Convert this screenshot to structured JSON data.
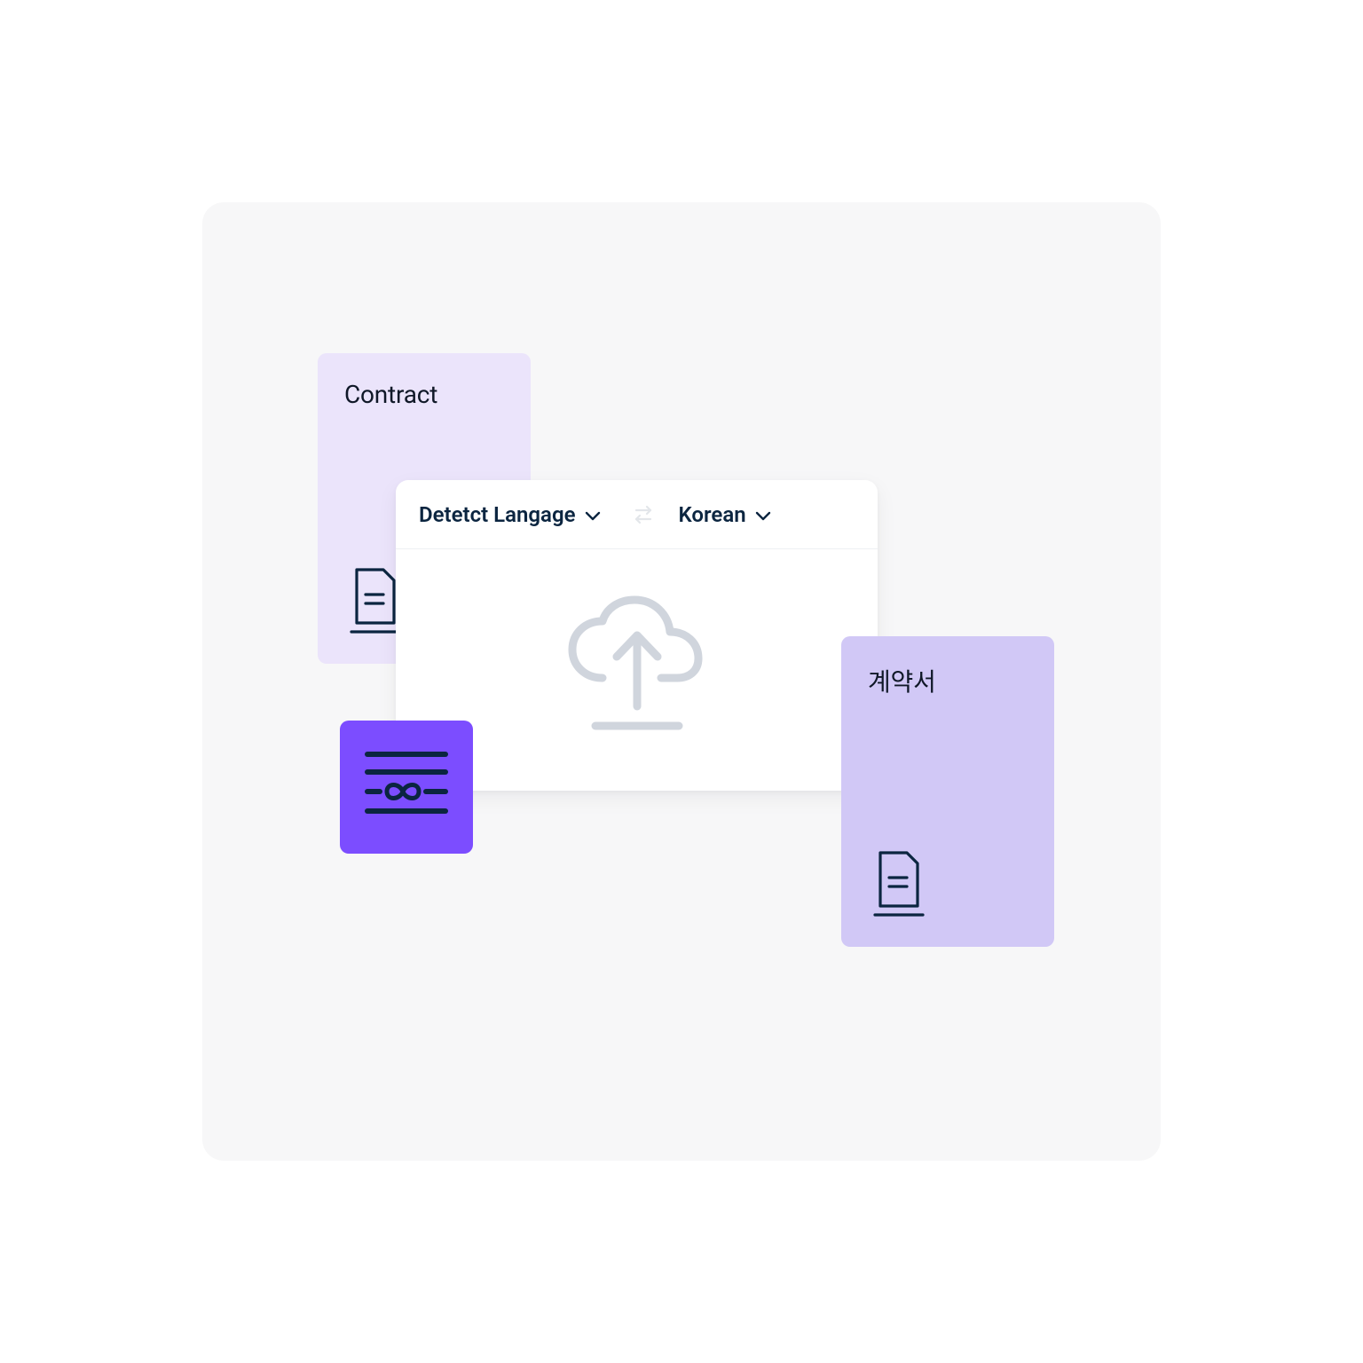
{
  "translator": {
    "source_language_label": "Detetct Langage",
    "target_language_label": "Korean"
  },
  "cards": {
    "source": {
      "title": "Contract"
    },
    "target": {
      "title": "계약서"
    }
  },
  "colors": {
    "ink": "#0b2540",
    "lavender_light": "#ebe4fb",
    "lavender": "#d1c8f6",
    "purple": "#7c4dff",
    "panel_bg": "#ffffff",
    "stage_bg": "#f7f7f8",
    "upload_icon": "#d0d5dd"
  },
  "icons": {
    "doc": "document-icon",
    "swap": "swap-arrows-icon",
    "upload": "cloud-upload-icon",
    "infinity_lines": "text-wrap-infinity-icon",
    "chevron": "chevron-down-icon"
  }
}
